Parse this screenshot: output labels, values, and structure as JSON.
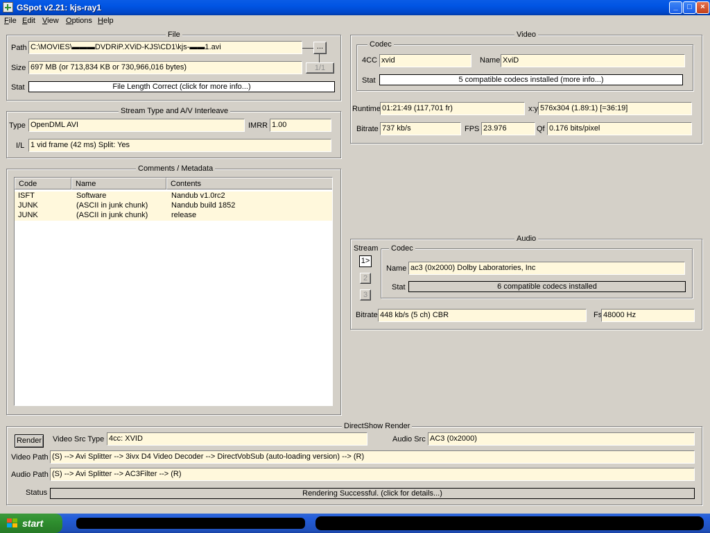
{
  "window": {
    "title": "GSpot v2.21: kjs-ray1",
    "caption_buttons": {
      "minimize": "_",
      "maximize": "□",
      "close": "×"
    }
  },
  "menu": [
    "File",
    "Edit",
    "View",
    "Options",
    "Help"
  ],
  "file": {
    "title": "File",
    "path_label": "Path",
    "path_value": "C:\\MOVIES\\▬▬▬DVDRiP.XViD-KJS\\CD1\\kjs-▬▬1.avi",
    "browse_label": "...",
    "size_label": "Size",
    "size_value": "697 MB (or 713,834 KB or 730,966,016 bytes)",
    "part_label": "1/1",
    "stat_label": "Stat",
    "stat_value": "File Length Correct (click for more info...)"
  },
  "stream": {
    "title": "Stream Type and A/V Interleave",
    "type_label": "Type",
    "type_value": "OpenDML AVI",
    "imrr_label": "IMRR",
    "imrr_value": "1.00",
    "il_label": "I/L",
    "il_value": "1 vid frame (42 ms)  Split: Yes"
  },
  "comments": {
    "title": "Comments / Metadata",
    "columns": [
      "Code",
      "Name",
      "Contents"
    ],
    "rows": [
      {
        "code": "ISFT",
        "name": "Software",
        "contents": "Nandub v1.0rc2"
      },
      {
        "code": "JUNK",
        "name": "(ASCII in junk chunk)",
        "contents": "Nandub build 1852"
      },
      {
        "code": "JUNK",
        "name": "(ASCII in junk chunk)",
        "contents": "release"
      }
    ]
  },
  "video": {
    "title": "Video",
    "codec_title": "Codec",
    "fourcc_label": "4CC",
    "fourcc_value": "xvid",
    "name_label": "Name",
    "name_value": "XviD",
    "stat_label": "Stat",
    "stat_value": "5 compatible codecs installed (more info...)",
    "runtime_label": "Runtime",
    "runtime_value": "01:21:49 (117,701 fr)",
    "xy_label": "x:y",
    "xy_value": "576x304 (1.89:1) [=36:19]",
    "bitrate_label": "Bitrate",
    "bitrate_value": "737 kb/s",
    "fps_label": "FPS",
    "fps_value": "23.976",
    "qf_label": "Qf",
    "qf_value": "0.176 bits/pixel"
  },
  "audio": {
    "title": "Audio",
    "stream_label": "Stream",
    "streams": [
      "1>",
      "2",
      "3"
    ],
    "codec_title": "Codec",
    "name_label": "Name",
    "name_value": "ac3 (0x2000) Dolby Laboratories, Inc",
    "stat_label": "Stat",
    "stat_value": "6 compatible codecs installed",
    "bitrate_label": "Bitrate",
    "bitrate_value": "448 kb/s (5 ch) CBR",
    "fs_label": "Fs",
    "fs_value": "48000 Hz"
  },
  "directshow": {
    "title": "DirectShow Render",
    "render_label": "Render",
    "video_src_type_label": "Video Src Type",
    "video_src_type_value": "4cc: XVID",
    "audio_src_label": "Audio Src",
    "audio_src_value": "AC3 (0x2000)",
    "video_path_label": "Video Path",
    "video_path_value": "(S) --> Avi Splitter --> 3ivx D4 Video Decoder --> DirectVobSub (auto-loading version) --> (R)",
    "audio_path_label": "Audio Path",
    "audio_path_value": "(S) --> Avi Splitter --> AC3Filter --> (R)",
    "status_label": "Status",
    "status_value": "Rendering Successful.  (click for details...)"
  },
  "taskbar": {
    "start_label": "start"
  },
  "colors": {
    "field_bg": "#fff8dc",
    "dialog_bg": "#d4d0c8",
    "titlebar": "#0054e3"
  }
}
